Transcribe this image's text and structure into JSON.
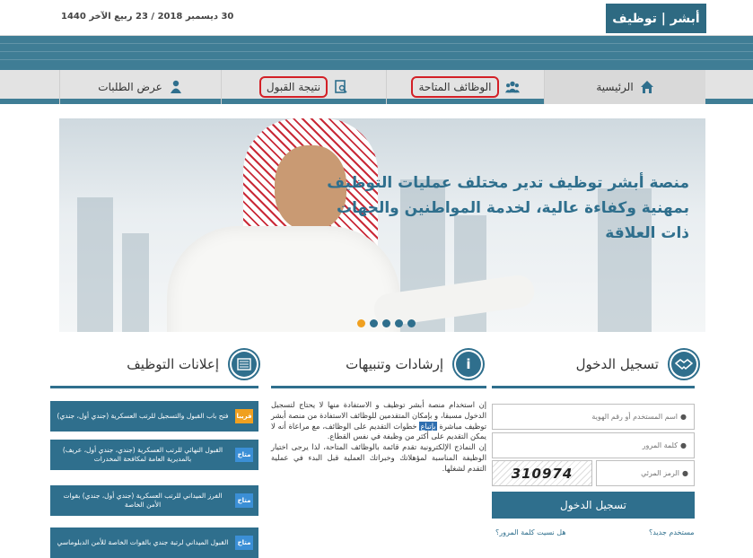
{
  "header": {
    "date": "30 ديسمبر 2018 / 23 ربيع الآخر 1440",
    "logo": "أبشر | توظيف"
  },
  "nav": {
    "home": "الرئيسية",
    "jobs": "الوظائف المتاحة",
    "result": "نتيجة القبول",
    "requests": "عرض الطلبات"
  },
  "hero": {
    "line1": "منصة أبشر توظيف تدير مختلف عمليات التوظيف",
    "line2": "بمهنية وكفاءة عالية، لخدمة المواطنين والجهات",
    "line3": "ذات العلاقة"
  },
  "login": {
    "title": "تسجيل الدخول",
    "username_placeholder": "اسم المستخدم أو رقم الهوية",
    "password_placeholder": "كلمة المرور",
    "captcha_placeholder": "الرمز المرئي",
    "captcha_text": "310974",
    "submit": "تسجيل الدخول",
    "new_user": "مستخدم جديد؟",
    "forgot": "هل نسيت كلمة المرور؟"
  },
  "guidance": {
    "title": "إرشادات وتنبيهات",
    "p1_before": "إن استخدام منصة أبشر توظيف و الاستفادة منها لا يحتاج لتسجيل الدخول مسبقا، و بإمكان المتقدمين للوظائف الاستفادة من منصة أبشر توظيف مباشرة",
    "p1_hl": "بإتباع",
    "p1_after": "خطوات التقديم على الوظائف، مع مراعاة أنه لا يمكن التقديم على أكثر من وظيفة في نفس القطاع.",
    "p2": "إن النماذج الإلكترونية تقدم قائمة بالوظائف المتاحة، لذا يرجى اختيار الوظيفة المناسبة لمؤهلاتك وخبراتك العملية قبل البدء في عملية التقدم لشغلها."
  },
  "ads": {
    "title": "إعلانات التوظيف",
    "items": [
      {
        "tag": "قريبا",
        "text": "فتح باب القبول والتسجيل للرتب العسكرية (جندي أول، جندي)"
      },
      {
        "tag": "متاح",
        "text": "القبول النهائي للرتب العسكرية (جندي، جندي أول، عريف) بالمديرية العامة لمكافحة المخدرات"
      },
      {
        "tag": "متاح",
        "text": "الفرز الميداني للرتب العسكرية (جندي أول، جندي) بقوات الأمن الخاصة"
      },
      {
        "tag": "متاح",
        "text": "القبول الميداني لرتبة جندي بالقوات الخاصة للأمن الدبلوماسي"
      }
    ]
  },
  "colors": {
    "primary": "#2f6f8d",
    "stripe": "#3f7d95",
    "highlight_circle": "#d32027",
    "soon_tag": "#f0a020",
    "available_tag": "#3b8fd6"
  }
}
